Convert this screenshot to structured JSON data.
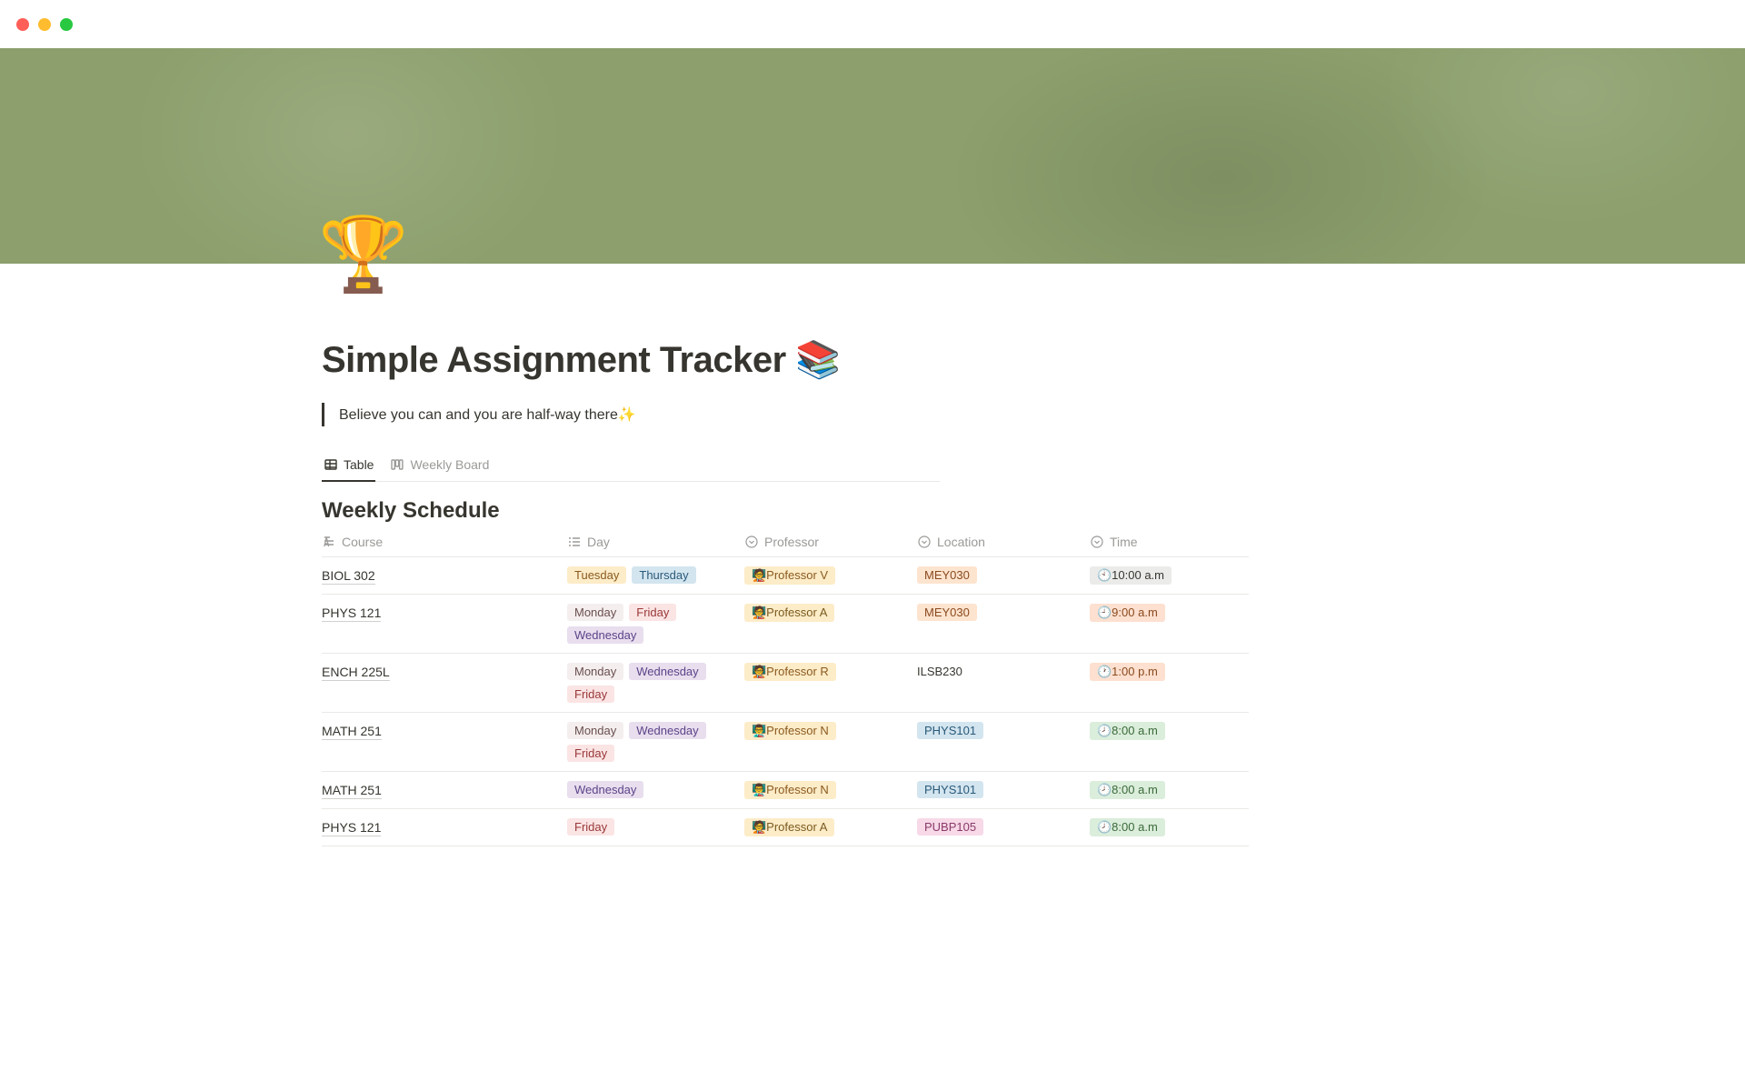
{
  "page": {
    "icon": "🏆",
    "title": "Simple Assignment Tracker 📚",
    "quote": "Believe you can and you are half-way there✨"
  },
  "tabs": [
    {
      "label": "Table",
      "active": true,
      "kind": "table"
    },
    {
      "label": "Weekly Board",
      "active": false,
      "kind": "board"
    }
  ],
  "section_title": "Weekly Schedule",
  "columns": {
    "course": "Course",
    "day": "Day",
    "professor": "Professor",
    "location": "Location",
    "time": "Time"
  },
  "day_tag_classes": {
    "Monday": "tag-monday",
    "Tuesday": "tag-tuesday",
    "Wednesday": "tag-wednesday",
    "Thursday": "tag-thursday",
    "Friday": "tag-friday"
  },
  "rows": [
    {
      "course": "BIOL 302",
      "days": [
        "Tuesday",
        "Thursday"
      ],
      "professor": {
        "text": "🧑‍🏫Professor V",
        "cls": "tag-profv"
      },
      "location": {
        "text": "MEY030",
        "cls": "tag-mey030"
      },
      "time": {
        "text": "🕙10:00 a.m",
        "cls": "tag-time-gray"
      }
    },
    {
      "course": "PHYS 121",
      "days": [
        "Monday",
        "Friday",
        "Wednesday"
      ],
      "professor": {
        "text": "🧑‍🏫Professor A",
        "cls": "tag-profa"
      },
      "location": {
        "text": "MEY030",
        "cls": "tag-mey030"
      },
      "time": {
        "text": "🕘9:00 a.m",
        "cls": "tag-time-peach"
      }
    },
    {
      "course": "ENCH 225L",
      "days": [
        "Monday",
        "Wednesday",
        "Friday"
      ],
      "professor": {
        "text": "🧑‍🏫Professor R",
        "cls": "tag-profr"
      },
      "location": {
        "text": "ILSB230",
        "cls": "tag-ilsb"
      },
      "time": {
        "text": "🕐1:00 p.m",
        "cls": "tag-time-peach"
      }
    },
    {
      "course": "MATH 251",
      "days": [
        "Monday",
        "Wednesday",
        "Friday"
      ],
      "professor": {
        "text": "👨‍🏫Professor N",
        "cls": "tag-profn"
      },
      "location": {
        "text": "PHYS101",
        "cls": "tag-phys101"
      },
      "time": {
        "text": "🕗8:00 a.m",
        "cls": "tag-time-green"
      }
    },
    {
      "course": "MATH 251",
      "days": [
        "Wednesday"
      ],
      "professor": {
        "text": "👨‍🏫Professor N",
        "cls": "tag-profn"
      },
      "location": {
        "text": "PHYS101",
        "cls": "tag-phys101"
      },
      "time": {
        "text": "🕗8:00 a.m",
        "cls": "tag-time-green"
      }
    },
    {
      "course": "PHYS 121",
      "days": [
        "Friday"
      ],
      "professor": {
        "text": "🧑‍🏫Professor A",
        "cls": "tag-profa"
      },
      "location": {
        "text": "PUBP105",
        "cls": "tag-pubp"
      },
      "time": {
        "text": "🕗8:00 a.m",
        "cls": "tag-time-green"
      }
    }
  ]
}
